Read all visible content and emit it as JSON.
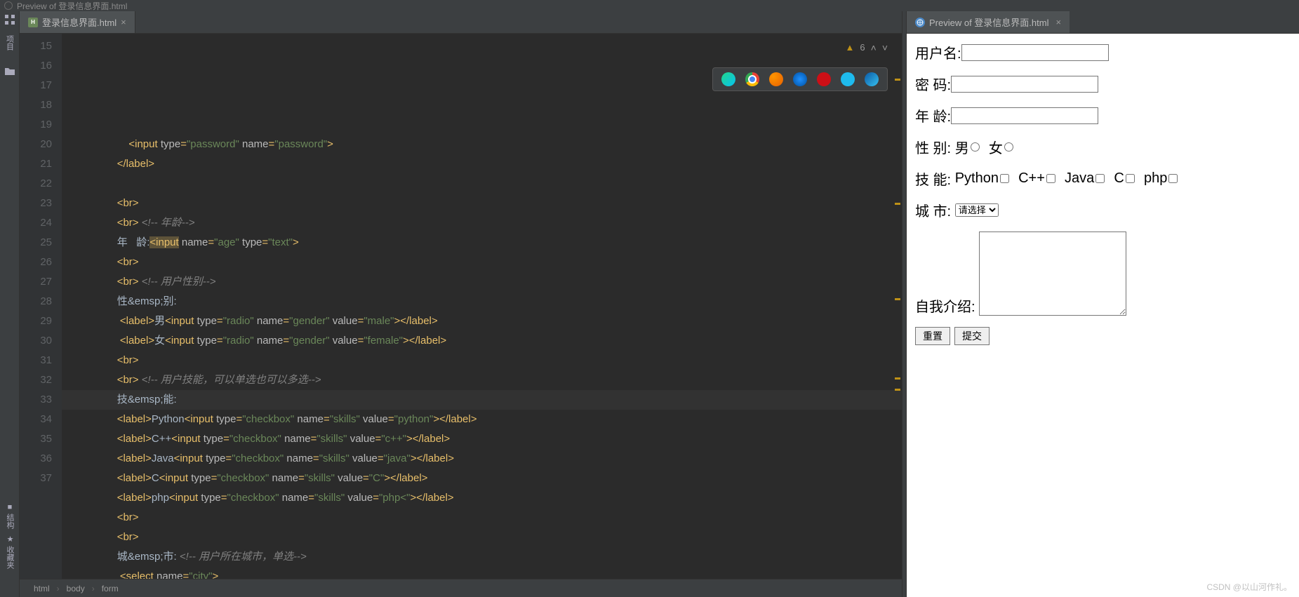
{
  "window_title": "Preview of 登录信息界面.html",
  "left_tools": {
    "project": "项目",
    "structure": "结构",
    "favorites": "收藏夹"
  },
  "editor_tab": {
    "filename": "登录信息界面.html"
  },
  "preview_tab": {
    "title": "Preview of 登录信息界面.html"
  },
  "inspection": {
    "warn_count": "6"
  },
  "gutter": {
    "start": 15,
    "end": 37
  },
  "code_lines": [
    {
      "indent": 20,
      "html": "<span class='tag'>&lt;input </span><span class='attr'>type</span><span class='tag'>=</span><span class='str'>\"password\"</span> <span class='attr'>name</span><span class='tag'>=</span><span class='str'>\"password\"</span><span class='tag'>&gt;</span>"
    },
    {
      "indent": 16,
      "html": "<span class='tag'>&lt;/label&gt;</span>"
    },
    {
      "indent": 0,
      "html": ""
    },
    {
      "indent": 16,
      "html": "<span class='tag'>&lt;br&gt;</span>"
    },
    {
      "indent": 16,
      "html": "<span class='tag'>&lt;br&gt;</span> <span class='cmt'>&lt;!-- 年龄--&gt;</span>"
    },
    {
      "indent": 16,
      "html": "<span class='txt'>年</span>   <span class='txt'>龄</span><span class='txt'>:</span><span class='sel-box'><span class='tag'>&lt;input</span></span> <span class='attr'>name</span><span class='tag'>=</span><span class='str'>\"age\"</span> <span class='attr'>type</span><span class='tag'>=</span><span class='str'>\"text\"</span><span class='tag'>&gt;</span>"
    },
    {
      "indent": 16,
      "html": "<span class='tag'>&lt;br&gt;</span>"
    },
    {
      "indent": 16,
      "html": "<span class='tag'>&lt;br&gt;</span> <span class='cmt'>&lt;!-- 用户性别--&gt;</span>"
    },
    {
      "indent": 16,
      "html": "<span class='txt'>性&amp;emsp;别:</span>"
    },
    {
      "indent": 17,
      "html": "<span class='tag'>&lt;label&gt;</span><span class='txt'>男</span><span class='tag'>&lt;input </span><span class='attr'>type</span><span class='tag'>=</span><span class='str'>\"radio\"</span> <span class='attr'>name</span><span class='tag'>=</span><span class='str'>\"gender\"</span> <span class='attr'>value</span><span class='tag'>=</span><span class='str'>\"male\"</span><span class='tag'>&gt;&lt;/label&gt;</span>"
    },
    {
      "indent": 17,
      "html": "<span class='tag'>&lt;label&gt;</span><span class='txt'>女</span><span class='tag'>&lt;input </span><span class='attr'>type</span><span class='tag'>=</span><span class='str'>\"radio\"</span> <span class='attr'>name</span><span class='tag'>=</span><span class='str'>\"gender\"</span> <span class='attr'>value</span><span class='tag'>=</span><span class='str'>\"female\"</span><span class='tag'>&gt;&lt;/label&gt;</span>"
    },
    {
      "indent": 16,
      "html": "<span class='tag'>&lt;br&gt;</span>"
    },
    {
      "indent": 16,
      "html": "<span class='tag'>&lt;br&gt;</span> <span class='cmt'>&lt;!-- 用户技能，可以单选也可以多选--&gt;</span>"
    },
    {
      "indent": 16,
      "html": "<span class='txt'>技&amp;emsp;能:</span>",
      "hl": true
    },
    {
      "indent": 16,
      "html": "<span class='tag'>&lt;label&gt;</span><span class='txt'>Python</span><span class='tag'>&lt;input </span><span class='attr'>type</span><span class='tag'>=</span><span class='str'>\"checkbox\"</span> <span class='attr'>name</span><span class='tag'>=</span><span class='str'>\"skills\"</span> <span class='attr'>value</span><span class='tag'>=</span><span class='str'>\"python\"</span><span class='tag'>&gt;&lt;/label&gt;</span>"
    },
    {
      "indent": 16,
      "html": "<span class='tag'>&lt;label&gt;</span><span class='txt'>C++</span><span class='tag'>&lt;input </span><span class='attr'>type</span><span class='tag'>=</span><span class='str'>\"checkbox\"</span> <span class='attr'>name</span><span class='tag'>=</span><span class='str'>\"skills\"</span> <span class='attr'>value</span><span class='tag'>=</span><span class='str'>\"c++\"</span><span class='tag'>&gt;&lt;/label&gt;</span>"
    },
    {
      "indent": 16,
      "html": "<span class='tag'>&lt;label&gt;</span><span class='txt'>Java</span><span class='tag'>&lt;input </span><span class='attr'>type</span><span class='tag'>=</span><span class='str'>\"checkbox\"</span> <span class='attr'>name</span><span class='tag'>=</span><span class='str'>\"skills\"</span> <span class='attr'>value</span><span class='tag'>=</span><span class='str'>\"java\"</span><span class='tag'>&gt;&lt;/label&gt;</span>"
    },
    {
      "indent": 16,
      "html": "<span class='tag'>&lt;label&gt;</span><span class='txt'>C</span><span class='tag'>&lt;input </span><span class='attr'>type</span><span class='tag'>=</span><span class='str'>\"checkbox\"</span> <span class='attr'>name</span><span class='tag'>=</span><span class='str'>\"skills\"</span> <span class='attr'>value</span><span class='tag'>=</span><span class='str'>\"C\"</span><span class='tag'>&gt;&lt;/label&gt;</span>"
    },
    {
      "indent": 16,
      "html": "<span class='tag'>&lt;label&gt;</span><span class='txt'>php</span><span class='tag'>&lt;input </span><span class='attr'>type</span><span class='tag'>=</span><span class='str'>\"checkbox\"</span> <span class='attr'>name</span><span class='tag'>=</span><span class='str'>\"skills\"</span> <span class='attr'>value</span><span class='tag'>=</span><span class='str'>\"php&lt;\"</span><span class='tag'>&gt;&lt;/label&gt;</span>"
    },
    {
      "indent": 16,
      "html": "<span class='tag'>&lt;br&gt;</span>"
    },
    {
      "indent": 16,
      "html": "<span class='tag'>&lt;br&gt;</span>"
    },
    {
      "indent": 16,
      "html": "<span class='txt'>城&amp;emsp;市:</span> <span class='cmt'>&lt;!-- 用户所在城市，单选--&gt;</span>"
    },
    {
      "indent": 17,
      "html": "<span class='tag'>&lt;select </span><span class='attr'>name</span><span class='tag'>=</span><span class='str'>\"city\"</span><span class='tag'>&gt;</span>"
    }
  ],
  "breadcrumb": [
    "html",
    "body",
    "form"
  ],
  "preview": {
    "username": "用户名:",
    "password": "密   码:",
    "age": "年   龄:",
    "gender": "性   别:",
    "gender_male": "男",
    "gender_female": "女",
    "skills": "技   能:",
    "skill_list": [
      "Python",
      "C++",
      "Java",
      "C",
      "php"
    ],
    "city": "城   市:",
    "city_opt": "请选择",
    "intro": "自我介绍:",
    "reset": "重置",
    "submit": "提交"
  },
  "watermark": "CSDN @以山河作礼。"
}
